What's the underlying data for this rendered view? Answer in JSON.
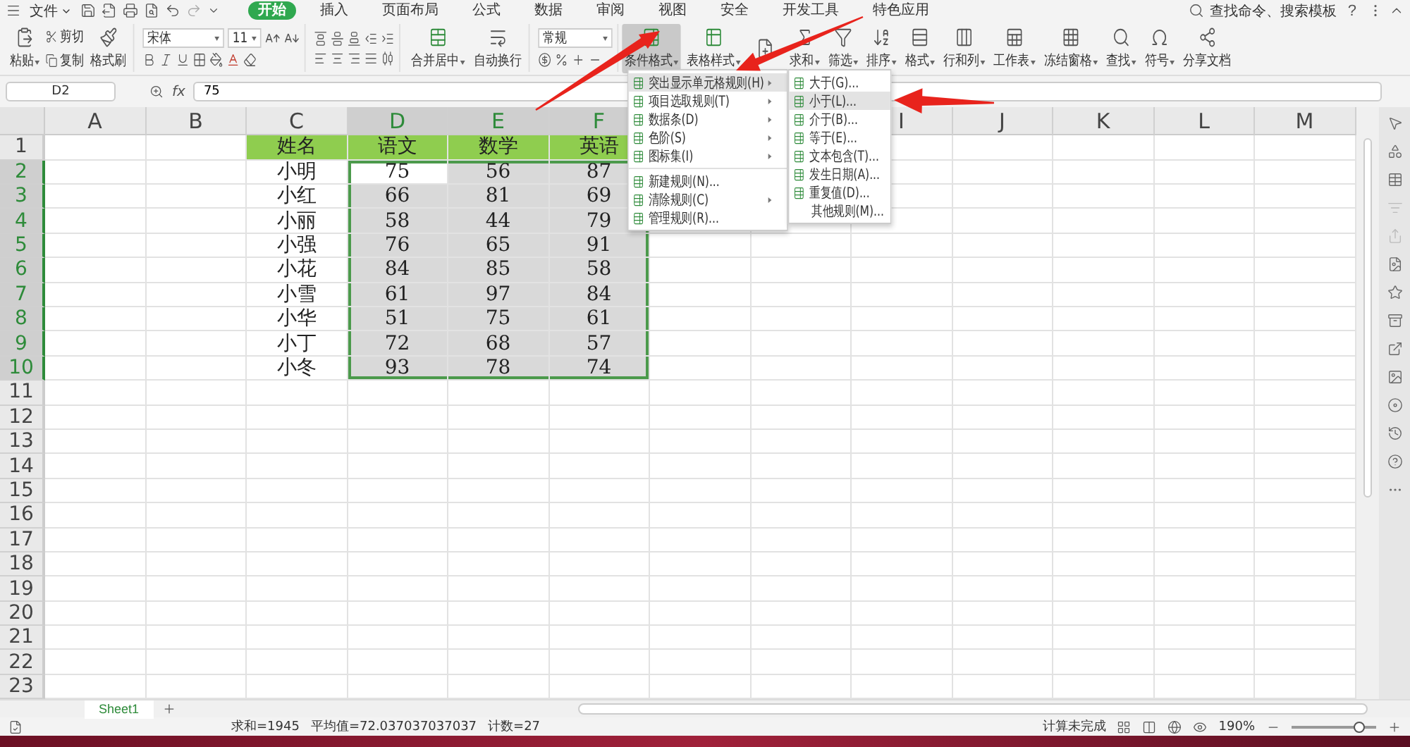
{
  "menu_bar": {
    "file": "文件",
    "tabs": [
      {
        "label": "开始",
        "selected": true
      },
      {
        "label": "插入",
        "selected": false
      },
      {
        "label": "页面布局",
        "selected": false
      },
      {
        "label": "公式",
        "selected": false
      },
      {
        "label": "数据",
        "selected": false
      },
      {
        "label": "审阅",
        "selected": false
      },
      {
        "label": "视图",
        "selected": false
      },
      {
        "label": "安全",
        "selected": false
      },
      {
        "label": "开发工具",
        "selected": false
      },
      {
        "label": "特色应用",
        "selected": false
      }
    ],
    "search": "查找命令、搜索模板",
    "help": "?"
  },
  "ribbon": {
    "paste": "粘贴",
    "cut": "剪切",
    "copy": "复制",
    "format_painter": "格式刷",
    "font": "宋体",
    "font_size": "11",
    "merge": "合并居中",
    "wrap": "自动换行",
    "number_format": "常规",
    "table_tools": [
      {
        "label": "条件格式",
        "pressed": true
      },
      {
        "label": "表格样式",
        "pressed": false
      }
    ],
    "tools": [
      {
        "label": "求和",
        "dropdown": true
      },
      {
        "label": "筛选",
        "dropdown": true
      },
      {
        "label": "排序",
        "dropdown": true
      },
      {
        "label": "格式",
        "dropdown": true
      },
      {
        "label": "行和列",
        "dropdown": true
      },
      {
        "label": "工作表",
        "dropdown": true
      },
      {
        "label": "冻结窗格",
        "dropdown": true
      },
      {
        "label": "查找",
        "dropdown": true
      },
      {
        "label": "符号",
        "dropdown": true
      },
      {
        "label": "分享文档",
        "dropdown": false
      }
    ]
  },
  "formula_bar": {
    "name_box": "D2",
    "fx": "fx",
    "formula": "75"
  },
  "sheet": {
    "columns": [
      {
        "label": "A",
        "selected": false
      },
      {
        "label": "B",
        "selected": false
      },
      {
        "label": "C",
        "selected": false
      },
      {
        "label": "D",
        "selected": true
      },
      {
        "label": "E",
        "selected": true
      },
      {
        "label": "F",
        "selected": true
      },
      {},
      {},
      {
        "label": "I",
        "selected": false
      },
      {
        "label": "J",
        "selected": false
      },
      {
        "label": "K",
        "selected": false
      },
      {
        "label": "L",
        "selected": false
      },
      {
        "label": "M",
        "selected": false
      }
    ],
    "rows": [
      {
        "label": "1",
        "selected": false
      },
      {
        "label": "2",
        "selected": true
      },
      {
        "label": "3",
        "selected": true
      },
      {
        "label": "4",
        "selected": true
      },
      {
        "label": "5",
        "selected": true
      },
      {
        "label": "6",
        "selected": true
      },
      {
        "label": "7",
        "selected": true
      },
      {
        "label": "8",
        "selected": true
      },
      {
        "label": "9",
        "selected": true
      },
      {
        "label": "10",
        "selected": true
      },
      {
        "label": "11",
        "selected": false
      },
      {
        "label": "12",
        "selected": false
      },
      {
        "label": "13",
        "selected": false
      },
      {
        "label": "14",
        "selected": false
      },
      {
        "label": "15",
        "selected": false
      },
      {
        "label": "16",
        "selected": false
      },
      {
        "label": "17",
        "selected": false
      },
      {
        "label": "18",
        "selected": false
      },
      {
        "label": "19",
        "selected": false
      },
      {
        "label": "20",
        "selected": false
      },
      {
        "label": "21",
        "selected": false
      },
      {
        "label": "22",
        "selected": false
      },
      {
        "label": "23",
        "selected": false
      }
    ],
    "table": {
      "header": [
        "姓名",
        "语文",
        "数学",
        "英语"
      ],
      "rows": [
        {
          "name": "小明",
          "scores": [
            {
              "value": "75",
              "active": true
            },
            {
              "value": "56",
              "active": false
            },
            {
              "value": "87",
              "active": false
            }
          ]
        },
        {
          "name": "小红",
          "scores": [
            {
              "value": "66",
              "active": false
            },
            {
              "value": "81",
              "active": false
            },
            {
              "value": "69",
              "active": false
            }
          ]
        },
        {
          "name": "小丽",
          "scores": [
            {
              "value": "58",
              "active": false
            },
            {
              "value": "44",
              "active": false
            },
            {
              "value": "79",
              "active": false
            }
          ]
        },
        {
          "name": "小强",
          "scores": [
            {
              "value": "76",
              "active": false
            },
            {
              "value": "65",
              "active": false
            },
            {
              "value": "91",
              "active": false
            }
          ]
        },
        {
          "name": "小花",
          "scores": [
            {
              "value": "84",
              "active": false
            },
            {
              "value": "85",
              "active": false
            },
            {
              "value": "58",
              "active": false
            }
          ]
        },
        {
          "name": "小雪",
          "scores": [
            {
              "value": "61",
              "active": false
            },
            {
              "value": "97",
              "active": false
            },
            {
              "value": "84",
              "active": false
            }
          ]
        },
        {
          "name": "小华",
          "scores": [
            {
              "value": "51",
              "active": false
            },
            {
              "value": "75",
              "active": false
            },
            {
              "value": "61",
              "active": false
            }
          ]
        },
        {
          "name": "小丁",
          "scores": [
            {
              "value": "72",
              "active": false
            },
            {
              "value": "68",
              "active": false
            },
            {
              "value": "57",
              "active": false
            }
          ]
        },
        {
          "name": "小冬",
          "scores": [
            {
              "value": "93",
              "active": false
            },
            {
              "value": "78",
              "active": false
            },
            {
              "value": "74",
              "active": false
            }
          ]
        }
      ]
    }
  },
  "dropdown_menu": {
    "groups": [
      [
        {
          "label": "突出显示单元格规则(H)",
          "submenu": true,
          "highlighted": true
        },
        {
          "label": "项目选取规则(T)",
          "submenu": true,
          "highlighted": false
        },
        {
          "label": "数据条(D)",
          "submenu": true,
          "highlighted": false
        },
        {
          "label": "色阶(S)",
          "submenu": true,
          "highlighted": false
        },
        {
          "label": "图标集(I)",
          "submenu": true,
          "highlighted": false
        }
      ],
      [
        {
          "label": "新建规则(N)...",
          "submenu": false,
          "highlighted": false
        },
        {
          "label": "清除规则(C)",
          "submenu": true,
          "highlighted": false
        },
        {
          "label": "管理规则(R)...",
          "submenu": false,
          "highlighted": false
        }
      ]
    ]
  },
  "submenu": {
    "items": [
      {
        "label": "大于(G)...",
        "kind": "rule",
        "highlighted": false
      },
      {
        "label": "小于(L)...",
        "kind": "rule",
        "highlighted": true
      },
      {
        "label": "介于(B)...",
        "kind": "rule",
        "highlighted": false
      },
      {
        "label": "等于(E)...",
        "kind": "rule",
        "highlighted": false
      },
      {
        "label": "文本包含(T)...",
        "kind": "rule",
        "highlighted": false
      },
      {
        "label": "发生日期(A)...",
        "kind": "rule",
        "highlighted": false
      },
      {
        "label": "重复值(D)...",
        "kind": "rule",
        "highlighted": false
      },
      {
        "label": "其他规则(M)...",
        "kind": "plain",
        "highlighted": false
      }
    ]
  },
  "sheet_tabs": [
    {
      "label": "Sheet1",
      "selected": true
    }
  ],
  "status_bar": {
    "sum": "求和=1945",
    "average": "平均值=72.037037037037",
    "count": "计数=27",
    "calc": "计算未完成",
    "zoom": "190%",
    "zoom_slider": {
      "level": 0.8
    }
  }
}
